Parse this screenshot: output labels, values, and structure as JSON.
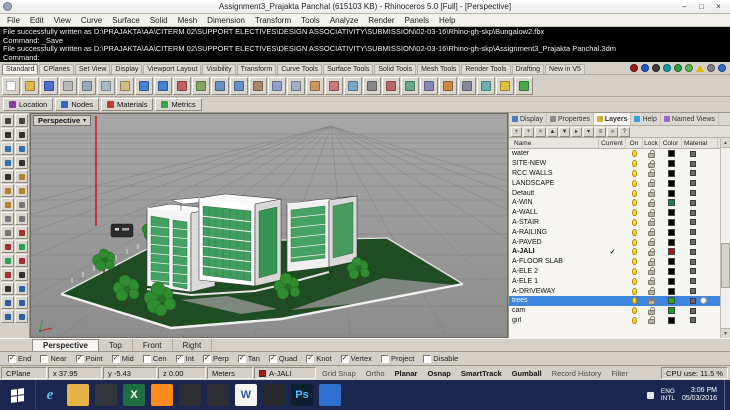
{
  "window": {
    "title": "Assignment3_Prajakta Panchal (615103 KB) - Rhinoceros 5.0 [Full] - [Perspective]",
    "controls": {
      "minimize": "–",
      "maximize": "□",
      "close": "×"
    }
  },
  "menu": [
    "File",
    "Edit",
    "View",
    "Curve",
    "Surface",
    "Solid",
    "Mesh",
    "Dimension",
    "Transform",
    "Tools",
    "Analyze",
    "Render",
    "Panels",
    "Help"
  ],
  "command": {
    "history": [
      "File successfully written as D:\\PRAJAKTA\\AA\\CITERM 02\\SUPPORT ELECTIVES\\DESIGN ASSOCIATIVITY\\SUBMISSION\\02-03-16\\Rhino-gh-skp\\Bungalow2.fbx",
      "Command: _Save",
      "File successfully written as D:\\PRAJAKTA\\AA\\CITERM 02\\SUPPORT ELECTIVES\\DESIGN ASSOCIATIVITY\\SUBMISSION\\02-03-16\\Rhino-gh-skp\\Assignment3_Prajakta Panchal.3dm"
    ],
    "prompt": "Command:"
  },
  "toolbar_tabs": [
    "Standard",
    "CPlanes",
    "Set View",
    "Display",
    "Viewport Layout",
    "Visibility",
    "Transform",
    "Curve Tools",
    "Surface Tools",
    "Solid Tools",
    "Mesh Tools",
    "Render Tools",
    "Drafting",
    "New in V5"
  ],
  "render_icons": [
    {
      "name": "red-sphere-icon",
      "color": "#9e1b1b"
    },
    {
      "name": "blue-sphere-icon",
      "color": "#2057c0"
    },
    {
      "name": "dark-sphere-icon",
      "color": "#3a3a3a"
    },
    {
      "name": "teal-sphere-icon",
      "color": "#0d9aa6"
    },
    {
      "name": "green-sphere-icon",
      "color": "#2f9e42"
    },
    {
      "name": "leaf-icon",
      "color": "#57b54b"
    },
    {
      "name": "warning-icon",
      "color": "#f0c020",
      "triangle": true
    },
    {
      "name": "gray-sphere-icon",
      "color": "#808080"
    },
    {
      "name": "globe-icon",
      "color": "#2a6fd4"
    }
  ],
  "main_toolbar": [
    {
      "name": "new-file-button",
      "c": "#f8f8f8"
    },
    {
      "name": "open-file-button",
      "c": "#e0b84e"
    },
    {
      "name": "save-file-button",
      "c": "#4e6fd0"
    },
    {
      "name": "print-button",
      "c": "#b8b8b8"
    },
    {
      "name": "cut-button",
      "c": "#98a8b8"
    },
    {
      "name": "copy-button",
      "c": "#a8b8c8"
    },
    {
      "name": "paste-button",
      "c": "#d0bc80"
    },
    {
      "name": "undo-button",
      "c": "#4880d0"
    },
    {
      "name": "redo-button",
      "c": "#4880d0"
    },
    {
      "name": "delete-button",
      "c": "#c06060"
    },
    {
      "name": "pan-button",
      "c": "#80a860"
    },
    {
      "name": "zoom-window-button",
      "c": "#6890c0"
    },
    {
      "name": "zoom-extents-button",
      "c": "#6890c0"
    },
    {
      "name": "rotate-view-button",
      "c": "#a88868"
    },
    {
      "name": "move-button",
      "c": "#90a0c8"
    },
    {
      "name": "copy-object-button",
      "c": "#a0b0c0"
    },
    {
      "name": "rotate-button",
      "c": "#c89860"
    },
    {
      "name": "scale-button",
      "c": "#c87878"
    },
    {
      "name": "mirror-button",
      "c": "#78a8c8"
    },
    {
      "name": "join-button",
      "c": "#888888"
    },
    {
      "name": "trim-button",
      "c": "#b86868"
    },
    {
      "name": "split-button",
      "c": "#68a888"
    },
    {
      "name": "extend-button",
      "c": "#8888b8"
    },
    {
      "name": "fillet-button",
      "c": "#c88848"
    },
    {
      "name": "offset-button",
      "c": "#8888a0"
    },
    {
      "name": "analyze-button",
      "c": "#68b0b0"
    },
    {
      "name": "layers-dialog-button",
      "c": "#e0c040"
    },
    {
      "name": "help-button",
      "c": "#48a848"
    }
  ],
  "custom_toolbar": [
    {
      "id": "location-button",
      "label": "Location",
      "icon_color": "#8a3aa0"
    },
    {
      "id": "nodes-button",
      "label": "Nodes",
      "icon_color": "#3a62c0"
    },
    {
      "id": "materials-button",
      "label": "Materials",
      "icon_color": "#c03a3a"
    },
    {
      "id": "metrics-button",
      "label": "Metrics",
      "icon_color": "#3aa04a"
    }
  ],
  "left_toolbar": [
    {
      "name": "select-tool",
      "c": "#444444"
    },
    {
      "name": "select-points-tool",
      "c": "#444444"
    },
    {
      "name": "line-tool",
      "c": "#303030"
    },
    {
      "name": "polyline-tool",
      "c": "#303030"
    },
    {
      "name": "curve-tool",
      "c": "#2f6fb0"
    },
    {
      "name": "circle-tool",
      "c": "#2f6fb0"
    },
    {
      "name": "arc-tool",
      "c": "#2f6fb0"
    },
    {
      "name": "rectangle-tool",
      "c": "#303030"
    },
    {
      "name": "polygon-tool",
      "c": "#303030"
    },
    {
      "name": "surface-tool",
      "c": "#b0812f"
    },
    {
      "name": "loft-tool",
      "c": "#b0812f"
    },
    {
      "name": "sweep-tool",
      "c": "#b0812f"
    },
    {
      "name": "revolve-tool",
      "c": "#b0812f"
    },
    {
      "name": "box-tool",
      "c": "#777777"
    },
    {
      "name": "sphere-tool",
      "c": "#777777"
    },
    {
      "name": "cylinder-tool",
      "c": "#777777"
    },
    {
      "name": "extrude-tool",
      "c": "#777777"
    },
    {
      "name": "boolean-union-tool",
      "c": "#a03030"
    },
    {
      "name": "boolean-difference-tool",
      "c": "#a03030"
    },
    {
      "name": "fillet-tool",
      "c": "#2f9e50"
    },
    {
      "name": "chamfer-tool",
      "c": "#2f9e50"
    },
    {
      "name": "trim-tool",
      "c": "#a03030"
    },
    {
      "name": "split-tool",
      "c": "#a03030"
    },
    {
      "name": "join-tool",
      "c": "#303030"
    },
    {
      "name": "explode-tool",
      "c": "#303030"
    },
    {
      "name": "move-tool",
      "c": "#2f5fa0"
    },
    {
      "name": "rotate-tool",
      "c": "#2f5fa0"
    },
    {
      "name": "scale-tool",
      "c": "#2f5fa0"
    },
    {
      "name": "mirror-tool",
      "c": "#2f5fa0"
    },
    {
      "name": "array-tool",
      "c": "#2f5fa0"
    }
  ],
  "viewport": {
    "label": "Perspective",
    "dropdown": "▾"
  },
  "panel": {
    "tabs": [
      {
        "label": "Display",
        "icon_color": "#4a7ac0"
      },
      {
        "label": "Properties",
        "icon_color": "#8a8a8a"
      },
      {
        "label": "Layers",
        "icon_color": "#d8b030",
        "active": true
      },
      {
        "label": "Help",
        "icon_color": "#38a0d8"
      },
      {
        "label": "Named Views",
        "icon_color": "#9a68c0"
      }
    ],
    "tools": [
      {
        "id": "new-layer-button",
        "glyph": "+"
      },
      {
        "id": "new-sublayer-button",
        "glyph": "+"
      },
      {
        "id": "delete-layer-button",
        "glyph": "×"
      },
      {
        "id": "move-up-button",
        "glyph": "▲"
      },
      {
        "id": "move-down-button",
        "glyph": "▼"
      },
      {
        "id": "expand-button",
        "glyph": "▸"
      },
      {
        "id": "collapse-button",
        "glyph": "▾"
      },
      {
        "id": "filter-button",
        "glyph": "≡"
      },
      {
        "id": "settings-button",
        "glyph": "»"
      },
      {
        "id": "help-button",
        "glyph": "?"
      }
    ]
  },
  "layers": {
    "columns": [
      "Name",
      "Current",
      "On",
      "Lock",
      "Color",
      "Material"
    ],
    "rows": [
      {
        "name": "water",
        "color": "#000000"
      },
      {
        "name": "SITE-NEW",
        "color": "#000000"
      },
      {
        "name": "RCC WALLS",
        "color": "#000000"
      },
      {
        "name": "LANDSCAPE",
        "color": "#000000"
      },
      {
        "name": "Default",
        "color": "#000000"
      },
      {
        "name": "A-WIN",
        "color": "#0e8040"
      },
      {
        "name": "A-WALL",
        "color": "#000000"
      },
      {
        "name": "A-STAIR",
        "color": "#000000"
      },
      {
        "name": "A-RAILING",
        "color": "#000000"
      },
      {
        "name": "A-PAVED",
        "color": "#000000"
      },
      {
        "name": "A-JALI",
        "color": "#a81616",
        "current": true
      },
      {
        "name": "A-FLOOR SLAB",
        "color": "#000000"
      },
      {
        "name": "A-ELE 2",
        "color": "#000000"
      },
      {
        "name": "A-ELE 1",
        "color": "#000000"
      },
      {
        "name": "A-DRIVEWAY",
        "color": "#000000"
      },
      {
        "name": "trees",
        "color": "#18b418",
        "selected": true,
        "material_dot": true
      },
      {
        "name": "cam",
        "color": "#18a018"
      },
      {
        "name": "girl",
        "color": "#000000"
      }
    ]
  },
  "viewport_tabs": [
    {
      "label": "Perspective",
      "active": true
    },
    {
      "label": "Top"
    },
    {
      "label": "Front"
    },
    {
      "label": "Right"
    }
  ],
  "osnap": [
    {
      "label": "End",
      "checked": true
    },
    {
      "label": "Near",
      "checked": false
    },
    {
      "label": "Point",
      "checked": true
    },
    {
      "label": "Mid",
      "checked": true
    },
    {
      "label": "Cen",
      "checked": false
    },
    {
      "label": "Int",
      "checked": true
    },
    {
      "label": "Perp",
      "checked": true
    },
    {
      "label": "Tan",
      "checked": true
    },
    {
      "label": "Quad",
      "checked": true
    },
    {
      "label": "Knot",
      "checked": true
    },
    {
      "label": "Vertex",
      "checked": true
    },
    {
      "label": "Project",
      "checked": false
    },
    {
      "label": "Disable",
      "checked": false
    }
  ],
  "status": {
    "cplane": "CPlane",
    "x": "x 37.95",
    "y": "y -5.43",
    "z": "z 0.00",
    "units": "Meters",
    "layer": "A-JALI",
    "layer_color": "#a81616",
    "toggles": [
      {
        "label": "Grid Snap"
      },
      {
        "label": "Ortho"
      },
      {
        "label": "Planar",
        "active": true
      },
      {
        "label": "Osnap",
        "active": true
      },
      {
        "label": "SmartTrack",
        "active": true
      },
      {
        "label": "Gumball",
        "active": true
      },
      {
        "label": "Record History"
      },
      {
        "label": "Filter"
      }
    ],
    "cpu": "CPU use: 11.5 %"
  },
  "taskbar": {
    "apps": [
      {
        "name": "internet-explorer",
        "glyph": "e",
        "bg": "transparent",
        "fg": "#5fc0f0",
        "ie": true
      },
      {
        "name": "file-explorer",
        "glyph": "",
        "bg": "#e8b44a",
        "fg": "#ffffff",
        "folder": true
      },
      {
        "name": "app-window-1",
        "glyph": "",
        "bg": "#34343c",
        "fg": "#ffffff"
      },
      {
        "name": "excel",
        "glyph": "X",
        "bg": "#1d6f42",
        "fg": "#ffffff"
      },
      {
        "name": "firefox",
        "glyph": "",
        "bg": "#ff8a1e",
        "fg": "#ffffff",
        "round": true
      },
      {
        "name": "app-window-2",
        "glyph": "",
        "bg": "#2e2e34",
        "fg": "#ffffff"
      },
      {
        "name": "app-window-3",
        "glyph": "",
        "bg": "#2e2e34",
        "fg": "#ffffff"
      },
      {
        "name": "word",
        "glyph": "W",
        "bg": "#f4f4f4",
        "fg": "#2b579a"
      },
      {
        "name": "app-window-4",
        "glyph": "",
        "bg": "#26262c",
        "fg": "#ffffff"
      },
      {
        "name": "photoshop",
        "glyph": "Ps",
        "bg": "#0b1f33",
        "fg": "#4fc1ff",
        "ps": true
      },
      {
        "name": "app-window-5",
        "glyph": "",
        "bg": "#2f6fd0",
        "fg": "#ffffff"
      }
    ],
    "tray": {
      "lang1": "ENG",
      "lang2": "INTL",
      "time": "3:06 PM",
      "date": "05/03/2016"
    }
  }
}
